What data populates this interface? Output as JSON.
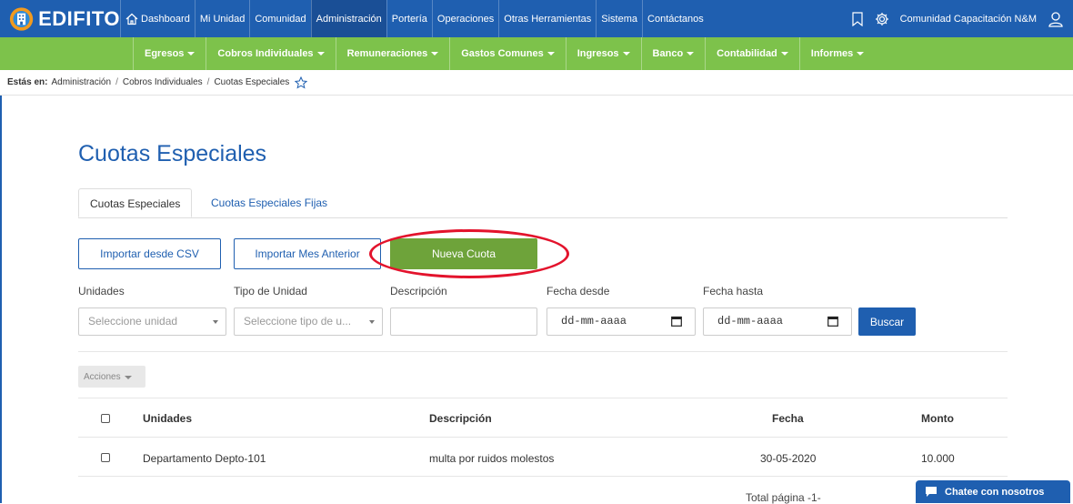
{
  "app": {
    "name": "EDIFITO"
  },
  "topnav": {
    "items": [
      "Dashboard",
      "Mi Unidad",
      "Comunidad",
      "Administración",
      "Portería",
      "Operaciones",
      "Otras Herramientas",
      "Sistema",
      "Contáctanos"
    ],
    "active": "Administración",
    "user": "Comunidad Capacitación N&M"
  },
  "subnav": {
    "items": [
      "Egresos",
      "Cobros Individuales",
      "Remuneraciones",
      "Gastos Comunes",
      "Ingresos",
      "Banco",
      "Contabilidad",
      "Informes"
    ]
  },
  "breadcrumb": {
    "label": "Estás en:",
    "items": [
      "Administración",
      "Cobros Individuales",
      "Cuotas Especiales"
    ]
  },
  "page": {
    "title": "Cuotas Especiales"
  },
  "tabs": [
    "Cuotas Especiales",
    "Cuotas Especiales Fijas"
  ],
  "actions": {
    "import_csv": "Importar desde CSV",
    "import_prev": "Importar Mes Anterior",
    "new_fee": "Nueva Cuota"
  },
  "filters": {
    "unidades_label": "Unidades",
    "unidades_placeholder": "Seleccione unidad",
    "tipo_label": "Tipo de Unidad",
    "tipo_placeholder": "Seleccione tipo de u...",
    "descripcion_label": "Descripción",
    "desde_label": "Fecha desde",
    "desde_placeholder": "dd-mm-aaaa",
    "hasta_label": "Fecha hasta",
    "hasta_placeholder": "dd-mm-aaaa",
    "search": "Buscar"
  },
  "bulk_actions": "Acciones",
  "table": {
    "headers": [
      "Unidades",
      "Descripción",
      "Fecha",
      "Monto"
    ],
    "rows": [
      {
        "unidad": "Departamento Depto-101",
        "descripcion": "multa por ruidos molestos",
        "fecha": "30-05-2020",
        "monto": "10.000"
      }
    ],
    "footer": "Total página -1-"
  },
  "chat": {
    "label": "Chatee con nosotros"
  },
  "colors": {
    "primary": "#1f5fb0",
    "green_bar": "#7dc24b",
    "button_green": "#6ea33a",
    "highlight": "#e3132c"
  }
}
